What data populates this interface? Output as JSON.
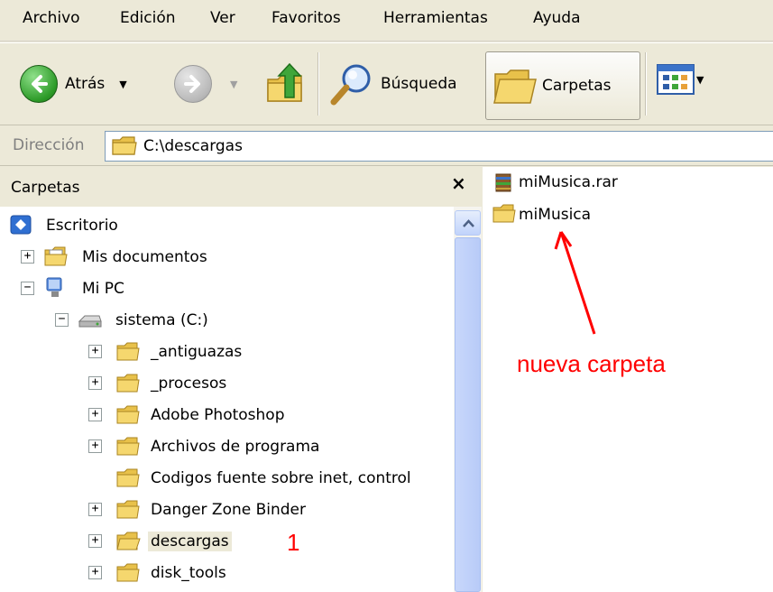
{
  "menu": {
    "items": [
      {
        "label": "Archivo"
      },
      {
        "label": "Edición"
      },
      {
        "label": "Ver"
      },
      {
        "label": "Favoritos"
      },
      {
        "label": "Herramientas"
      },
      {
        "label": "Ayuda"
      }
    ]
  },
  "toolbar": {
    "back_label": "Atrás",
    "search_label": "Búsqueda",
    "folders_label": "Carpetas"
  },
  "address": {
    "label": "Dirección",
    "value": "C:\\descargas"
  },
  "folders_pane": {
    "title": "Carpetas",
    "close": "×",
    "tree": [
      {
        "label": "Escritorio"
      },
      {
        "label": "Mis documentos"
      },
      {
        "label": "Mi PC"
      },
      {
        "label": "sistema (C:)"
      },
      {
        "label": "_antiguazas"
      },
      {
        "label": "_procesos"
      },
      {
        "label": "Adobe Photoshop"
      },
      {
        "label": "Archivos de programa"
      },
      {
        "label": "Codigos fuente sobre inet, control"
      },
      {
        "label": "Danger Zone Binder"
      },
      {
        "label": "descargas"
      },
      {
        "label": "disk_tools"
      }
    ]
  },
  "files": [
    {
      "label": "miMusica.rar"
    },
    {
      "label": "miMusica"
    }
  ],
  "annotations": {
    "new_folder": "nueva carpeta",
    "step_number": "1"
  },
  "colors": {
    "annotation": "#ff0000",
    "folder": "#f5d76e"
  }
}
